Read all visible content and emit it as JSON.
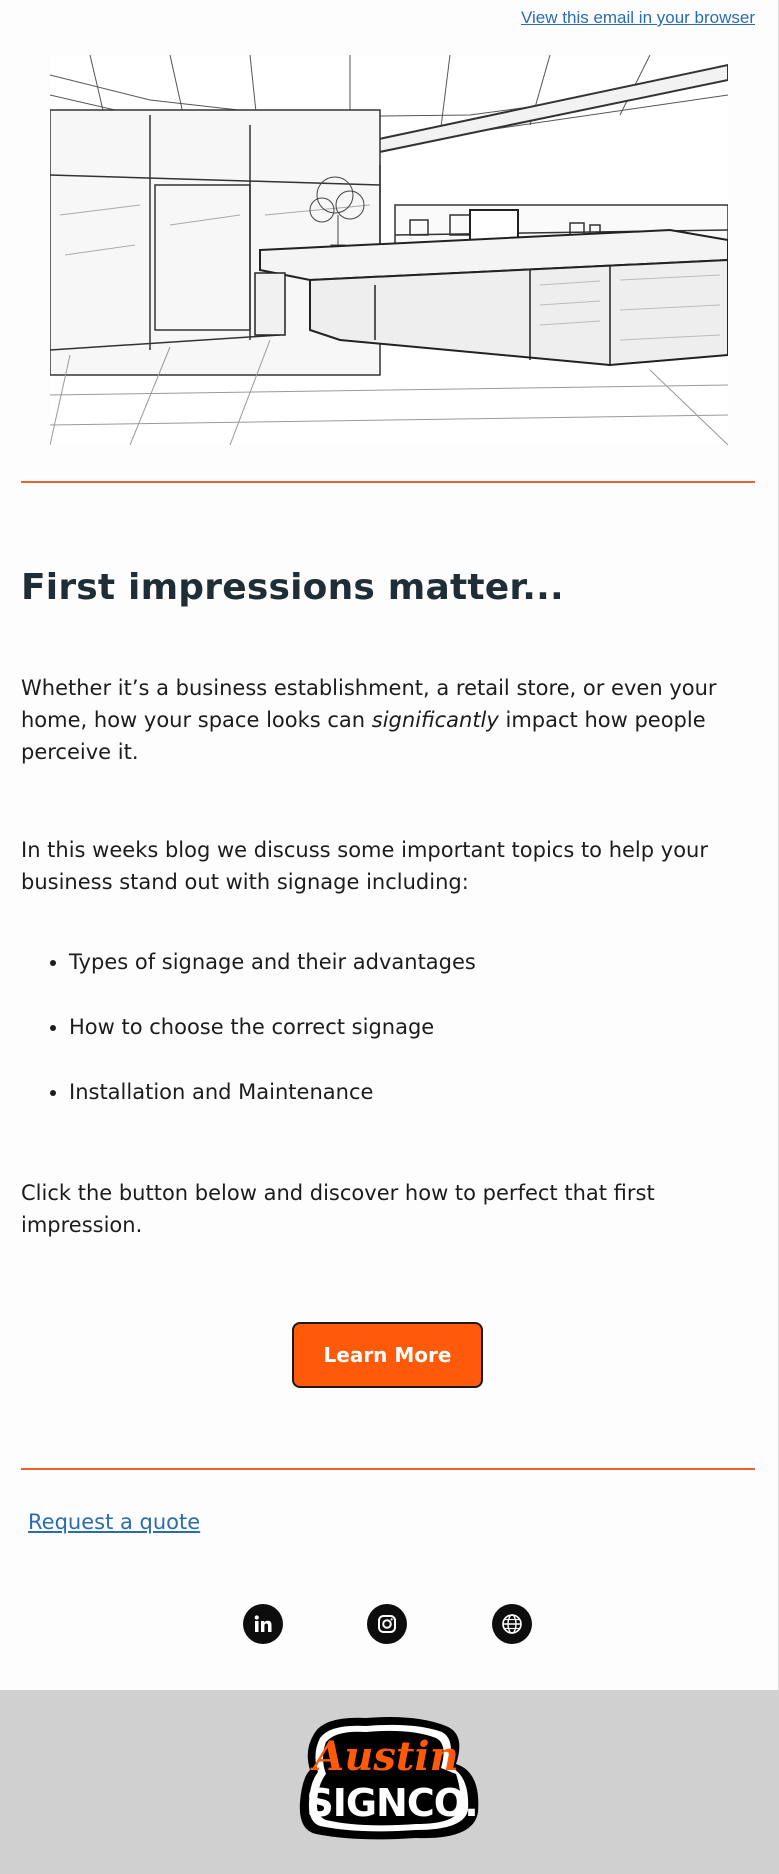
{
  "header": {
    "view_in_browser": "View this email in your browser"
  },
  "hero": {
    "image_icon": "reception-desk-sketch-illustration"
  },
  "content": {
    "headline": "First impressions matter...",
    "para1_before": "Whether it’s a business establishment, a retail store, or even your home, how your space looks can ",
    "para1_emph": "significantly",
    "para1_after": " impact how people perceive it.",
    "para2": "In this weeks blog we discuss some important topics to help your business stand out with signage including:",
    "bullets": [
      "Types of signage and their advantages",
      "How to choose the correct signage",
      "Installation and Maintenance"
    ],
    "para3": "Click the button below and discover how to perfect that first impression.",
    "cta_label": "Learn More"
  },
  "links": {
    "request_quote": "Request a quote"
  },
  "social": [
    {
      "name": "linkedin-icon"
    },
    {
      "name": "instagram-icon"
    },
    {
      "name": "globe-icon"
    }
  ],
  "footer": {
    "logo_line1": "Austin",
    "logo_line2": "SIGNCO."
  },
  "colors": {
    "accent": "#ff5a0a",
    "divider": "#e8632e",
    "link": "#2b6cb0",
    "headline": "#1f2e36",
    "footer_bg": "#d0d0d0"
  }
}
